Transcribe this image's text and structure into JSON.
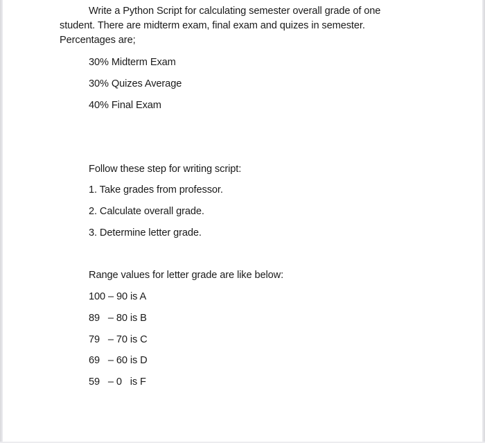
{
  "document": {
    "intro_lines": [
      "Write a Python Script for calculating semester overall grade of one",
      "student. There are midterm exam, final exam and quizes in semester.",
      "Percentages are;"
    ],
    "percentages": [
      "30% Midterm Exam",
      "30% Quizes Average",
      "40% Final Exam"
    ],
    "steps_heading": "Follow these step for writing script:",
    "steps": [
      "1. Take grades from professor.",
      "2. Calculate overall grade.",
      "3. Determine letter grade."
    ],
    "ranges_heading": "Range values for letter grade are like below:",
    "ranges": [
      "100 – 90 is A",
      "89   – 80 is B",
      "79   – 70 is C",
      "69   – 60 is D",
      "59   – 0   is F"
    ]
  }
}
